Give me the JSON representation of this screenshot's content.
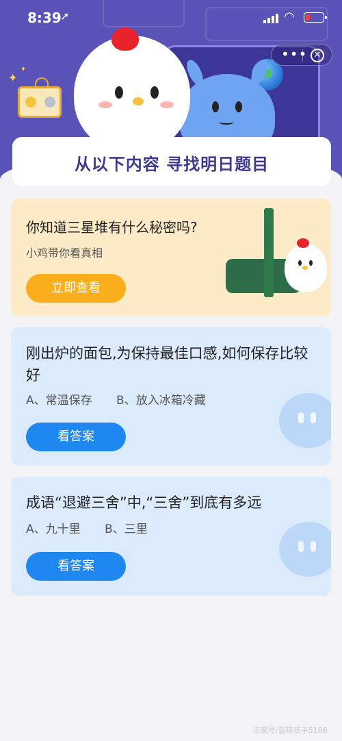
{
  "status_bar": {
    "time": "8:39",
    "location_icon": "location-arrow-icon",
    "signal_icon": "cellular-signal-icon",
    "wifi_icon": "wifi-icon",
    "battery_icon": "battery-low-icon",
    "battery_level": 0.15,
    "battery_color": "#ff3b30"
  },
  "capsule": {
    "more_label": "•••",
    "close_label": "✕"
  },
  "header": {
    "background_color": "#5b54b8",
    "banner_title": "从以下内容 寻找明日题目"
  },
  "promo_card": {
    "title": "你知道三星堆有什么秘密吗?",
    "subtitle": "小鸡带你看真相",
    "button_label": "立即查看",
    "background_color": "#fdebc8",
    "button_color": "#fbae1c"
  },
  "questions": [
    {
      "title": "刚出炉的面包,为保持最佳口感,如何保存比较好",
      "options": [
        "A、常温保存",
        "B、放入冰箱冷藏"
      ],
      "button_label": "看答案"
    },
    {
      "title": "成语“退避三舍”中,“三舍”到底有多远",
      "options": [
        "A、九十里",
        "B、三里"
      ],
      "button_label": "看答案"
    }
  ],
  "colors": {
    "question_card": "#dcebfc",
    "answer_button": "#1e88f0",
    "page_background": "#f3f3f5"
  },
  "watermark": "百家号/蓝转孩子5188"
}
